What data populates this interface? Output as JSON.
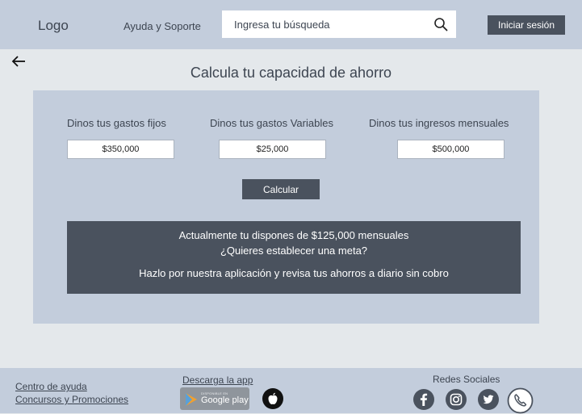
{
  "header": {
    "logo": "Logo",
    "help_link": "Ayuda y Soporte",
    "search_placeholder": "Ingresa tu búsqueda",
    "login_label": "Iniciar sesión"
  },
  "main": {
    "title": "Calcula tu capacidad de ahorro",
    "fields": [
      {
        "label": "Dinos tus gastos fijos",
        "value": "$350,000"
      },
      {
        "label": "Dinos tus gastos Variables",
        "value": "$25,000"
      },
      {
        "label": "Dinos tus ingresos mensuales",
        "value": "$500,000"
      }
    ],
    "calculate_label": "Calcular",
    "result": {
      "line1": "Actualmente tu dispones de $125,000 mensuales",
      "line2": "¿Quieres establecer una meta?",
      "line3": "Hazlo por nuestra aplicación y revisa tus ahorros a diario sin cobro"
    }
  },
  "footer": {
    "help_center": "Centro de ayuda",
    "contests": "Concursos y Promociones",
    "download_app": "Descarga la app",
    "google_play_small": "DISPONIBLE EN",
    "google_play": "Google play",
    "social_title": "Redes Sociales",
    "social_icons": [
      "facebook-icon",
      "instagram-icon",
      "twitter-icon",
      "phone-icon"
    ]
  },
  "colors": {
    "bar": "#c3cddc",
    "background": "#e4e8eb",
    "dark": "#4a525e"
  }
}
